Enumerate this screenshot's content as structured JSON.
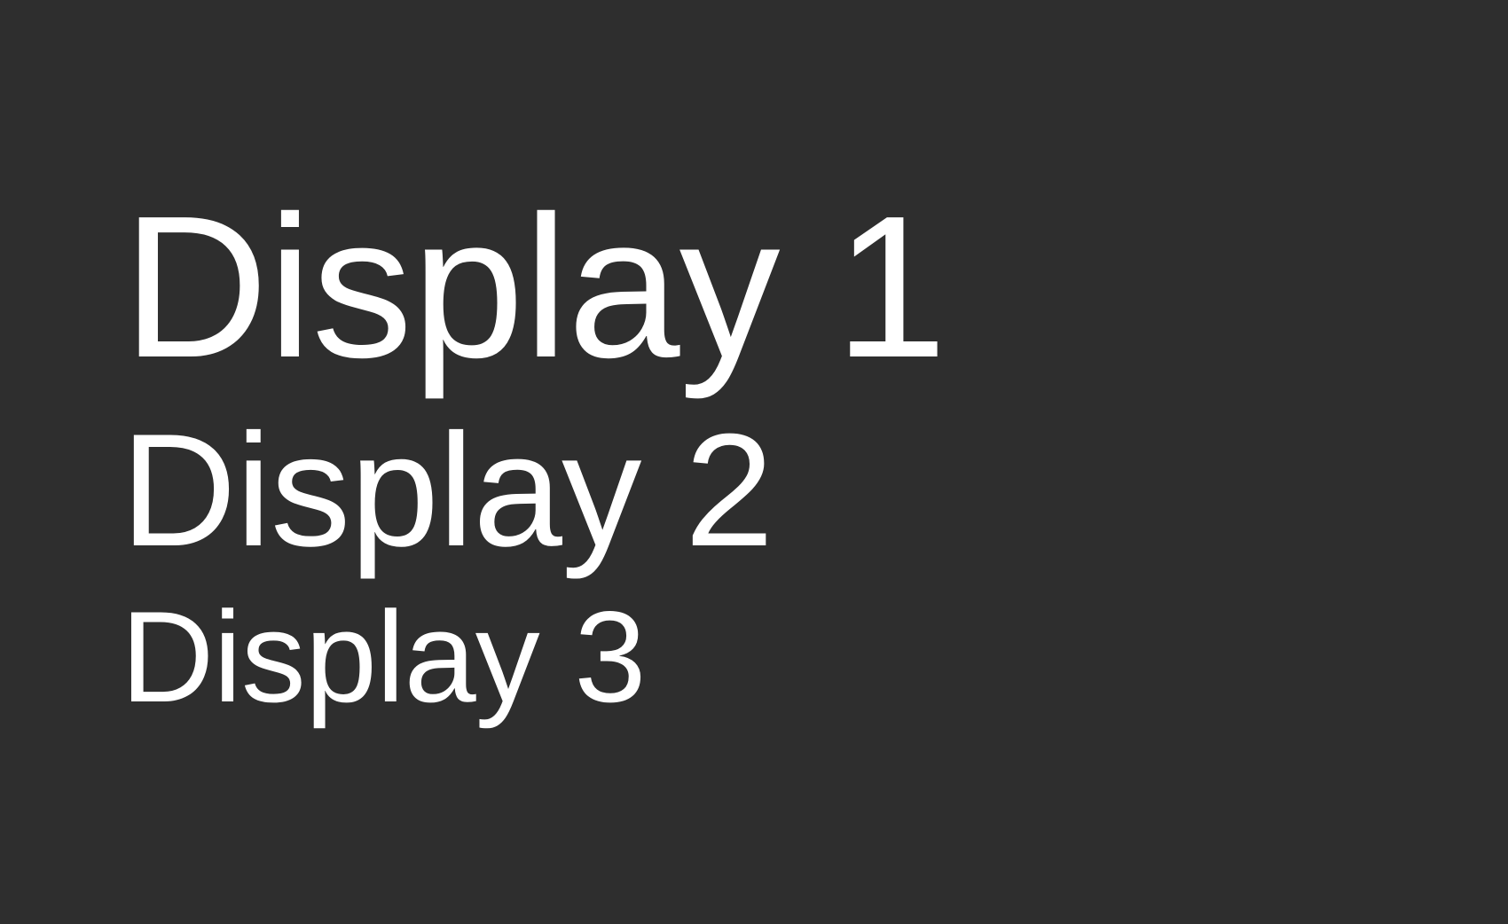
{
  "headings": {
    "display1": "Display 1",
    "display2": "Display 2",
    "display3": "Display 3"
  },
  "colors": {
    "background": "#2e2e2e",
    "text": "#ffffff"
  }
}
